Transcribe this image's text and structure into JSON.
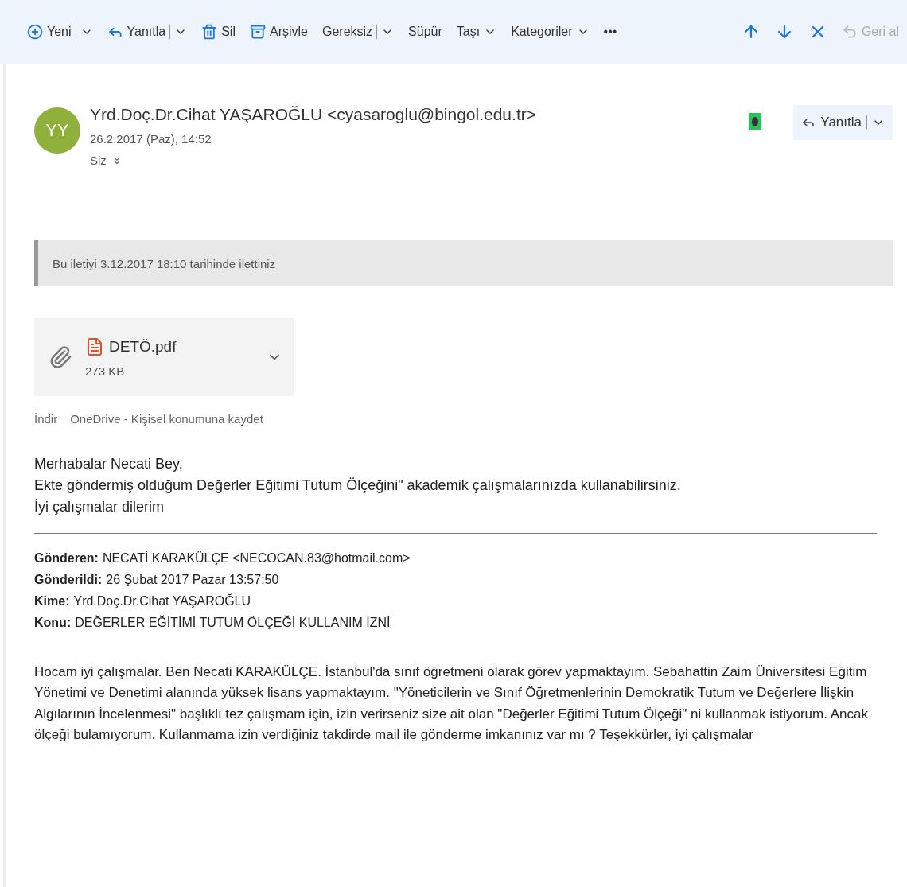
{
  "toolbar": {
    "left": [
      {
        "label": "Yeni",
        "kind": "split"
      },
      {
        "label": "Yanıtla",
        "kind": "split"
      },
      {
        "label": "Sil",
        "kind": "plain"
      },
      {
        "label": "Arşivle",
        "kind": "plain"
      },
      {
        "label": "Gereksiz",
        "kind": "split"
      },
      {
        "label": "Süpür",
        "kind": "plain"
      },
      {
        "label": "Taşı",
        "kind": "dropdown"
      },
      {
        "label": "Kategoriler",
        "kind": "dropdown"
      },
      {
        "label": "•••",
        "kind": "plain"
      }
    ],
    "right": [
      {
        "disabled": false
      },
      {
        "disabled": false
      },
      {
        "disabled": false
      },
      {
        "label": "Geri al",
        "disabled": true
      }
    ]
  },
  "message": {
    "avatar": "YY",
    "sender": "Yrd.Doç.Dr.Cihat YAŞAROĞLU <cyasaroglu@bingol.edu.tr>",
    "date": "26.2.2017 (Paz), 14:52",
    "recipients": "Siz",
    "reply_button": "Yanıtla",
    "notice": "Bu iletiyi 3.12.2017 18:10 tarihinde ilettiniz",
    "attachment": {
      "name": "DETÖ.pdf",
      "size": "273 KB",
      "actions": [
        "İndir",
        "OneDrive - Kişisel konumuna kaydet"
      ]
    },
    "body": [
      "Merhabalar Necati Bey,",
      "Ekte göndermiş olduğum Değerler Eğitimi Tutum Ölçeğini\" akademik çalışmalarınızda kullanabilirsiniz.",
      "İyi çalışmalar dilerim"
    ],
    "quoted_header": [
      {
        "label": "Gönderen:",
        "value": "NECATİ KARAKÜLÇE <NECOCAN.83@hotmail.com>"
      },
      {
        "label": "Gönderildi:",
        "value": "26 Şubat 2017 Pazar 13:57:50"
      },
      {
        "label": "Kime:",
        "value": "Yrd.Doç.Dr.Cihat YAŞAROĞLU"
      },
      {
        "label": "Konu:",
        "value": "DEĞERLER EĞİTİMİ TUTUM ÖLÇEĞİ KULLANIM İZNİ"
      }
    ],
    "quoted_body": "Hocam iyi çalışmalar. Ben Necati KARAKÜLÇE. İstanbul'da sınıf öğretmeni olarak görev yapmaktayım. Sebahattin Zaim Üniversitesi Eğitim Yönetimi ve Denetimi alanında yüksek lisans yapmaktayım. \"Yöneticilerin ve Sınıf Öğretmenlerinin Demokratik Tutum ve Değerlere İlişkin Algılarının İncelenmesi\" başlıklı tez çalışmam için, izin verirseniz size ait olan \"Değerler Eğitimi Tutum Ölçeği\" ni kullanmak istiyorum. Ancak ölçeği bulamıyorum. Kullanmama izin verdiğiniz takdirde mail ile gönderme imkanınız var mı ? Teşekkürler, iyi çalışmalar"
  }
}
